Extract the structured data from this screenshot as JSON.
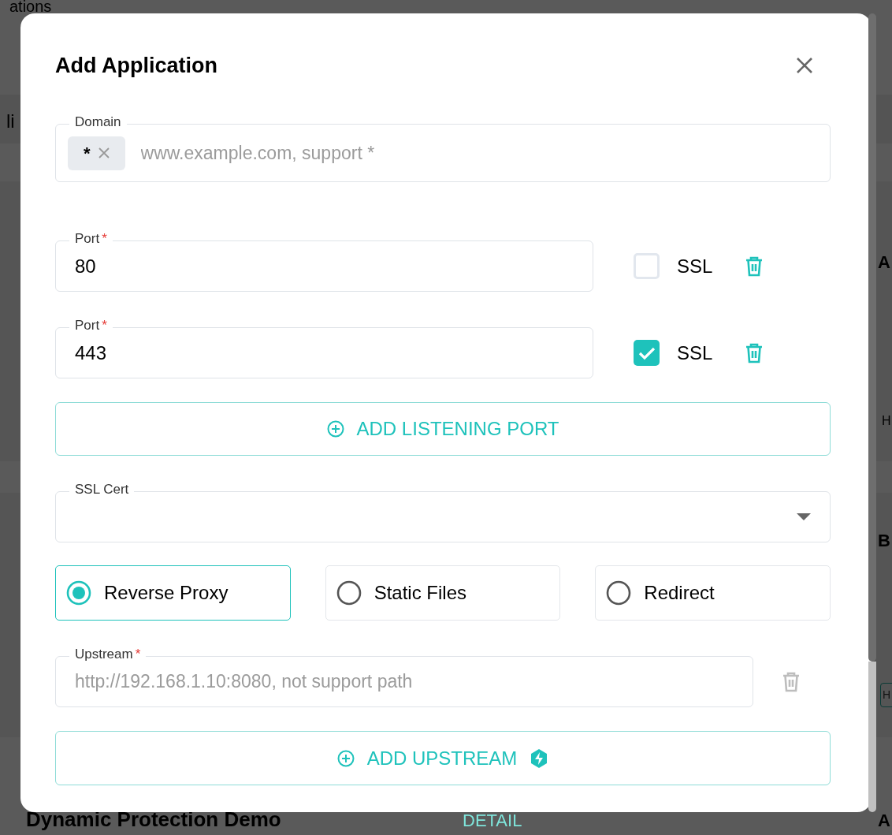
{
  "background": {
    "texts": [
      {
        "kind": "heading",
        "text": "ations"
      },
      {
        "kind": "tab",
        "text": "li"
      },
      {
        "kind": "card-title",
        "text": "A"
      },
      {
        "kind": "card-text",
        "text": "H"
      },
      {
        "kind": "card-title-2",
        "text": "B"
      },
      {
        "kind": "card-button",
        "text": "H"
      },
      {
        "kind": "row-title",
        "text": "Dynamic Protection Demo"
      },
      {
        "kind": "row-link",
        "text": "DETAIL"
      },
      {
        "kind": "row-end",
        "text": "A"
      }
    ]
  },
  "dialog": {
    "title": "Add Application"
  },
  "domain": {
    "label": "Domain",
    "tags": [
      "*"
    ],
    "placeholder": "www.example.com, support *"
  },
  "ports": [
    {
      "label": "Port",
      "required_mark": "*",
      "value": "80",
      "ssl_label": "SSL",
      "ssl": false
    },
    {
      "label": "Port",
      "required_mark": "*",
      "value": "443",
      "ssl_label": "SSL",
      "ssl": true
    }
  ],
  "add_port_button": "ADD LISTENING PORT",
  "ssl_cert": {
    "label": "SSL Cert"
  },
  "modes": [
    {
      "label": "Reverse Proxy",
      "selected": true
    },
    {
      "label": "Static Files",
      "selected": false
    },
    {
      "label": "Redirect",
      "selected": false
    }
  ],
  "upstreams": [
    {
      "label": "Upstream",
      "required_mark": "*",
      "placeholder": "http://192.168.1.10:8080, not support path",
      "delete_disabled": true
    }
  ],
  "add_upstream_button": "ADD UPSTREAM"
}
